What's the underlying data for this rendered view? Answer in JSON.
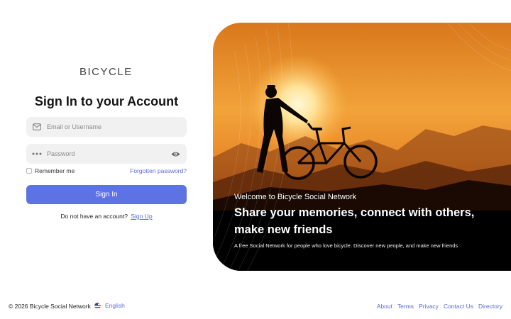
{
  "logo": {
    "text": "BICYCLE"
  },
  "login": {
    "title": "Sign In to your Account",
    "email_placeholder": "Email or Username",
    "password_placeholder": "Password",
    "remember_label": "Remember me",
    "forgot_label": "Forgotten password?",
    "signin_label": "Sign In",
    "no_account_text": "Do not have an account?",
    "signup_label": "Sign Up"
  },
  "hero": {
    "welcome": "Welcome to Bicycle Social Network",
    "title": "Share your memories, connect with others, make new friends",
    "subtitle": "A free Social Network for people who love bicycle. Discover new people, and make new friends"
  },
  "footer": {
    "copyright": "© 2026 Bicycle Social Network",
    "language": "English",
    "links": [
      "About",
      "Terms",
      "Privacy",
      "Contact Us",
      "Directory"
    ]
  },
  "colors": {
    "accent": "#5e73e3",
    "link": "#5b6bd9",
    "field_bg": "#f1f1f1"
  },
  "icons": [
    "mail-icon",
    "password-dots-icon",
    "eye-icon",
    "us-flag-icon"
  ]
}
